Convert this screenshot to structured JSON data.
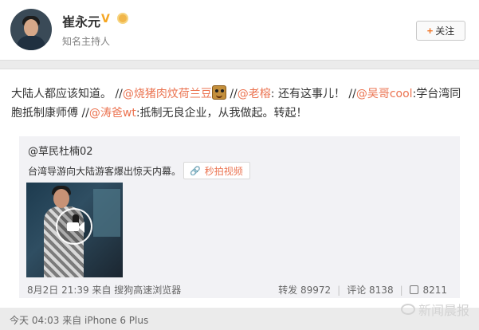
{
  "profile": {
    "name": "崔永元",
    "verified_badge": "V",
    "description": "知名主持人",
    "follow_label": "关注",
    "follow_symbol": "+"
  },
  "post": {
    "segments": [
      {
        "type": "text",
        "text": "大陆人都应该知道。 //"
      },
      {
        "type": "mention",
        "text": "@烧猪肉炆荷兰豆"
      },
      {
        "type": "emoji",
        "name": "emoji-icon"
      },
      {
        "type": "text",
        "text": " //"
      },
      {
        "type": "mention",
        "text": "@老榕"
      },
      {
        "type": "text",
        "text": ": 还有这事儿！ //"
      },
      {
        "type": "mention",
        "text": "@吴哥cool"
      },
      {
        "type": "text",
        "text": ":学台湾同胞抵制康师傅 //"
      },
      {
        "type": "mention",
        "text": "@涛爸wt"
      },
      {
        "type": "text",
        "text": ":抵制无良企业，从我做起。转起！"
      }
    ]
  },
  "repost": {
    "author": "@草民杜楠02",
    "text": "台湾导游向大陆游客爆出惊天内幕。",
    "video_link_label": "秒拍视频",
    "meta": "8月2日 21:39 来自 搜狗高速浏览器",
    "stats": {
      "forward": "转发 89972",
      "comment": "评论 8138",
      "like": "8211"
    }
  },
  "watermark": "新闻晨报",
  "footer": {
    "meta": "今天 04:03 来自 iPhone 6 Plus"
  },
  "colors": {
    "mention": "#eb7350",
    "background": "#ebebeb",
    "repost_bg": "#f2f2f5"
  }
}
